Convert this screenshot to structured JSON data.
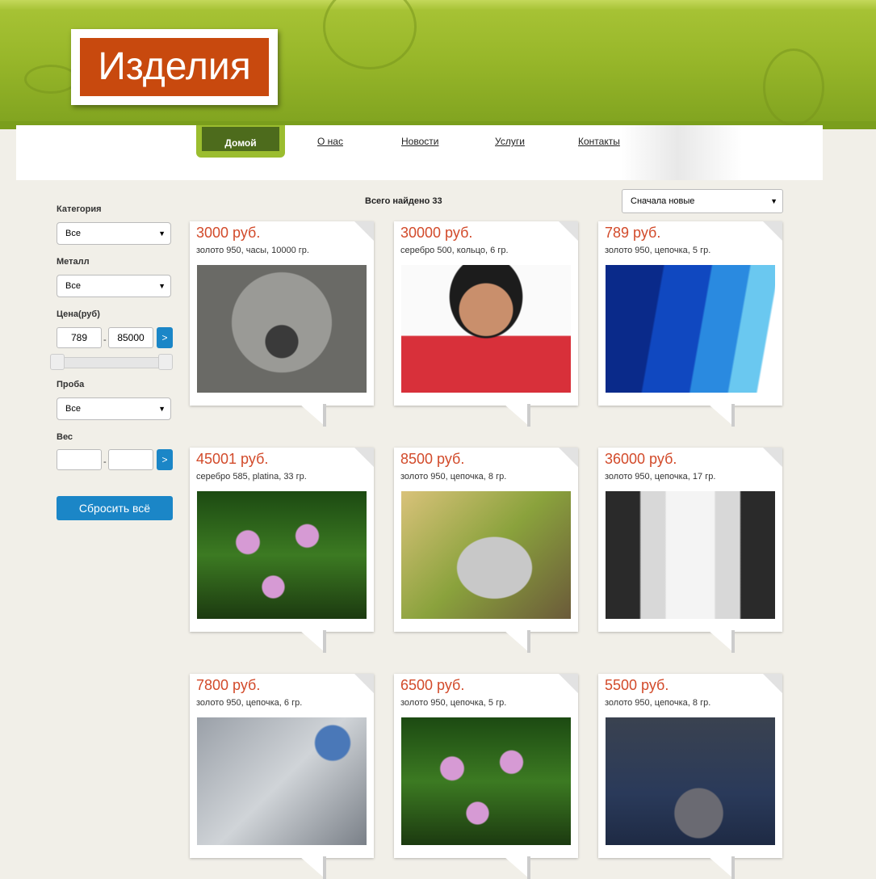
{
  "logo": {
    "title": "Изделия"
  },
  "nav": {
    "home": "Домой",
    "about": "О нас",
    "news": "Новости",
    "services": "Услуги",
    "contacts": "Контакты"
  },
  "filters": {
    "category_label": "Категория",
    "category_value": "Все",
    "metal_label": "Металл",
    "metal_value": "Все",
    "price_label": "Цена(руб)",
    "price_min": "789",
    "price_max": "85000",
    "go": ">",
    "dash": "-",
    "assay_label": "Проба",
    "assay_value": "Все",
    "weight_label": "Вес",
    "weight_min": "",
    "weight_max": "",
    "reset": "Сбросить всё"
  },
  "results": {
    "found": "Всего найдено 33",
    "sort": "Сначала новые"
  },
  "products": [
    {
      "price": "3000 руб.",
      "desc": "золото 950, часы, 10000 гр.",
      "image": "koala"
    },
    {
      "price": "30000 руб.",
      "desc": "серебро 500, кольцо, 6 гр.",
      "image": "woman-portrait"
    },
    {
      "price": "789 руб.",
      "desc": "золото 950, цепочка, 5 гр.",
      "image": "blue-waves"
    },
    {
      "price": "45001 руб.",
      "desc": "серебро 585, platina, 33 гр.",
      "image": "water-lilies"
    },
    {
      "price": "8500 руб.",
      "desc": "золото 950, цепочка, 8 гр.",
      "image": "kitten"
    },
    {
      "price": "36000 руб.",
      "desc": "золото 950, цепочка, 17 гр.",
      "image": "gallery-bridge"
    },
    {
      "price": "7800 руб.",
      "desc": "золото 950, цепочка, 6 гр.",
      "image": "cat-eye"
    },
    {
      "price": "6500 руб.",
      "desc": "золото 950, цепочка, 5 гр.",
      "image": "water-lilies"
    },
    {
      "price": "5500 руб.",
      "desc": "золото 950, цепочка, 8 гр.",
      "image": "grey-kitten"
    }
  ],
  "colors": {
    "header_green": "#98b72a",
    "logo_orange": "#c8490e",
    "price_red": "#d24a2a",
    "button_blue": "#1b86c7"
  }
}
